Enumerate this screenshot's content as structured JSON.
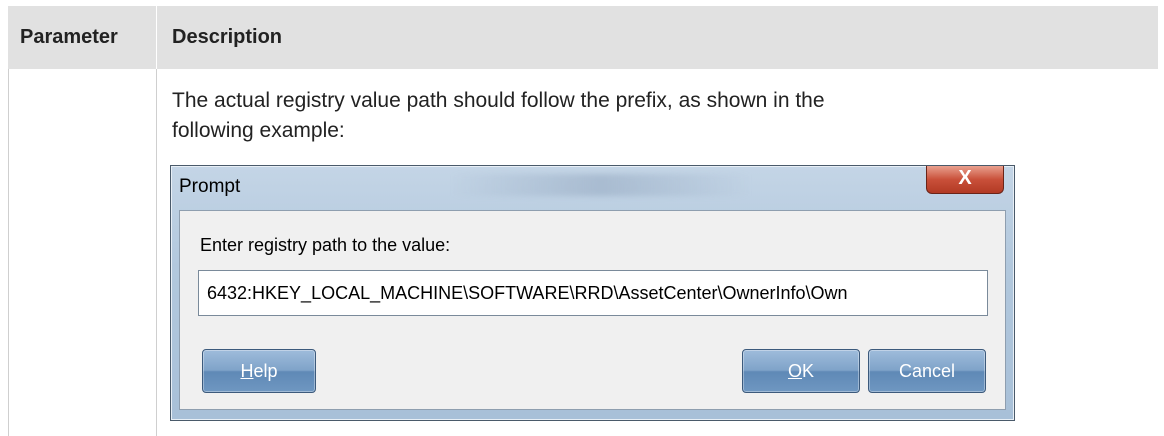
{
  "table": {
    "headers": [
      "Parameter",
      "Description"
    ],
    "description_text": "The actual registry value path should follow the prefix, as shown in the following example:"
  },
  "dialog": {
    "title": "Prompt",
    "close_glyph": "X",
    "label": "Enter registry path to the value:",
    "path_value": "6432:HKEY_LOCAL_MACHINE\\SOFTWARE\\RRD\\AssetCenter\\OwnerInfo\\Own",
    "help_label": {
      "accel": "H",
      "rest": "elp"
    },
    "ok_label": {
      "accel": "O",
      "rest": "K"
    },
    "cancel_label": "Cancel"
  },
  "colors": {
    "header_bg": "#e1e1e1",
    "dialog_frame": "#b2c8dd",
    "close_button": "#c9503a",
    "button_blue": "#7fa3c9"
  }
}
